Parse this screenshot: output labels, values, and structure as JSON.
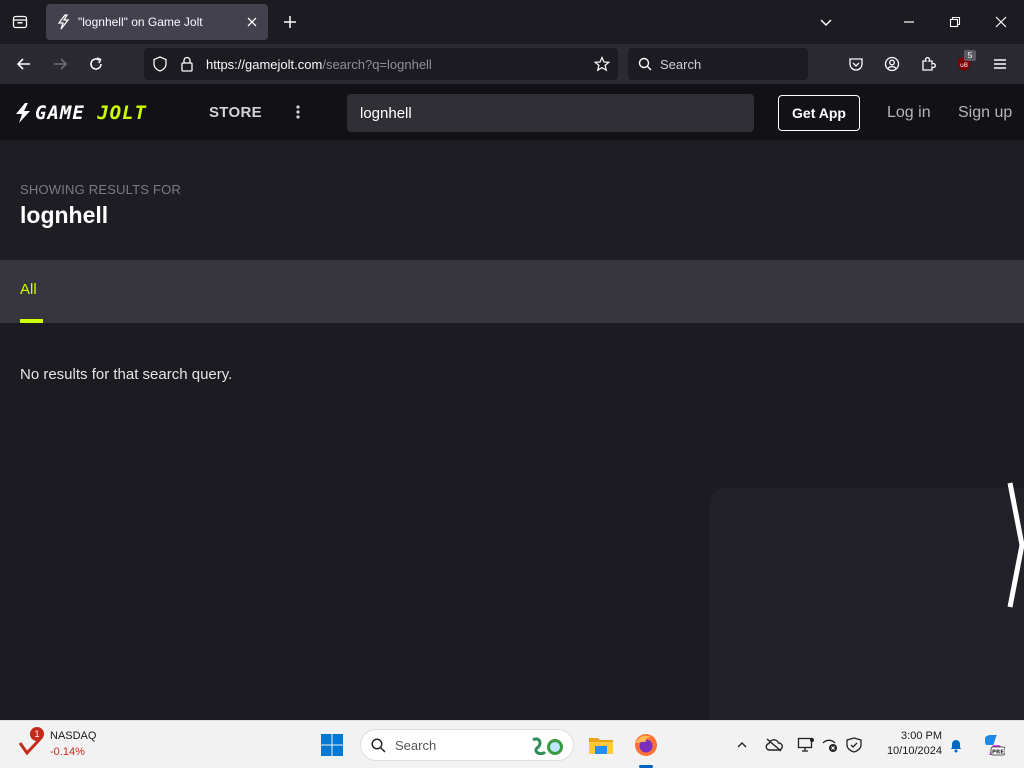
{
  "browser": {
    "tab_title": "\"lognhell\" on Game Jolt",
    "url_host": "https://gamejolt.com",
    "url_path": "/search?q=lognhell",
    "search_placeholder": "Search",
    "extension_badge": "5"
  },
  "site": {
    "logo_game": "GAME",
    "logo_jolt": "JOLT",
    "store_label": "STORE",
    "search_value": "lognhell",
    "get_app_label": "Get App",
    "login_label": "Log in",
    "signup_label": "Sign up"
  },
  "results": {
    "showing_label": "SHOWING RESULTS FOR",
    "query": "lognhell",
    "tabs": [
      {
        "label": "All",
        "active": true
      }
    ],
    "empty_message": "No results for that search query."
  },
  "taskbar": {
    "stock_name": "NASDAQ",
    "stock_change": "-0.14%",
    "stock_badge": "1",
    "search_label": "Search",
    "time": "3:00 PM",
    "date": "10/10/2024"
  },
  "colors": {
    "accent": "#ccff00",
    "page_bg": "#1c1b22",
    "header_bg": "#121116",
    "tabs_strip_bg": "#37363f"
  }
}
